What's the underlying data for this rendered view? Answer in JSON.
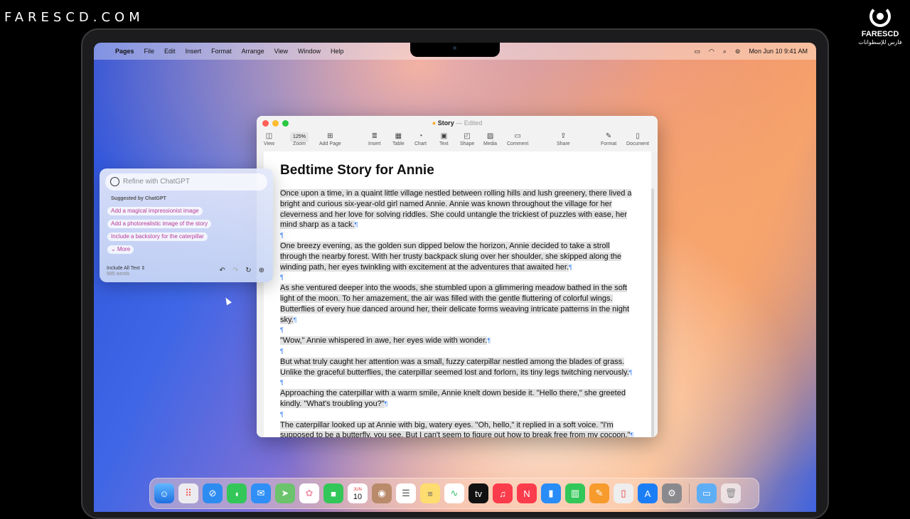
{
  "overlay": {
    "watermark": "FARESCD.COM",
    "brand_name": "FARESCD",
    "brand_sub": "فارس للإسطوانات"
  },
  "menubar": {
    "items": [
      "Pages",
      "File",
      "Edit",
      "Insert",
      "Format",
      "Arrange",
      "View",
      "Window",
      "Help"
    ],
    "datetime": "Mon Jun 10  9:41 AM"
  },
  "window": {
    "title": "Story",
    "status": "— Edited",
    "toolbar": {
      "view": "View",
      "zoom_value": "125%",
      "zoom": "Zoom",
      "add_page": "Add Page",
      "insert": "Insert",
      "table": "Table",
      "chart": "Chart",
      "text": "Text",
      "shape": "Shape",
      "media": "Media",
      "comment": "Comment",
      "share": "Share",
      "format": "Format",
      "document": "Document"
    }
  },
  "document": {
    "title": "Bedtime Story for Annie",
    "paragraphs": [
      "Once upon a time, in a quaint little village nestled between rolling hills and lush greenery, there lived a bright and curious six-year-old girl named Annie. Annie was known throughout the village for her cleverness and her love for solving riddles. She could untangle the trickiest of puzzles with ease, her mind sharp as a tack.",
      "One breezy evening, as the golden sun dipped below the horizon, Annie decided to take a stroll through the nearby forest. With her trusty backpack slung over her shoulder, she skipped along the winding path, her eyes twinkling with excitement at the adventures that awaited her.",
      "As she ventured deeper into the woods, she stumbled upon a glimmering meadow bathed in the soft light of the moon. To her amazement, the air was filled with the gentle fluttering of colorful wings. Butterflies of every hue danced around her, their delicate forms weaving intricate patterns in the night sky.",
      "\"Wow,\" Annie whispered in awe, her eyes wide with wonder.",
      "But what truly caught her attention was a small, fuzzy caterpillar nestled among the blades of grass. Unlike the graceful butterflies, the caterpillar seemed lost and forlorn, its tiny legs twitching nervously.",
      "Approaching the caterpillar with a warm smile, Annie knelt down beside it. \"Hello there,\" she greeted kindly. \"What's troubling you?\"",
      "The caterpillar looked up at Annie with big, watery eyes. \"Oh, hello,\" it replied in a soft voice. \"I'm supposed to be a butterfly, you see. But I can't seem to figure out how to break free from my cocoon.\""
    ],
    "pilcrow": "¶"
  },
  "chatgpt_panel": {
    "placeholder": "Refine with ChatGPT",
    "suggested_title": "Suggested by ChatGPT",
    "suggestions": [
      "Add a magical impressionist image",
      "Add a photorealistic image of the story",
      "Include a backstory for the caterpillar"
    ],
    "more": "More",
    "include_label": "Include All Text ⇕",
    "word_count": "585 words"
  },
  "dock": {
    "apps": [
      "finder-icon",
      "launchpad-icon",
      "safari-icon",
      "messages-icon",
      "mail-icon",
      "maps-icon",
      "photos-icon",
      "facetime-icon",
      "calendar-icon",
      "contacts-icon",
      "reminders-icon",
      "notes-icon",
      "freeform-icon",
      "tv-icon",
      "music-icon",
      "news-icon",
      "keynote-icon",
      "numbers-icon",
      "pages-icon",
      "iphone-mirroring-icon",
      "app-store-icon",
      "system-settings-icon"
    ],
    "calendar_month": "JUN",
    "calendar_day": "10"
  }
}
